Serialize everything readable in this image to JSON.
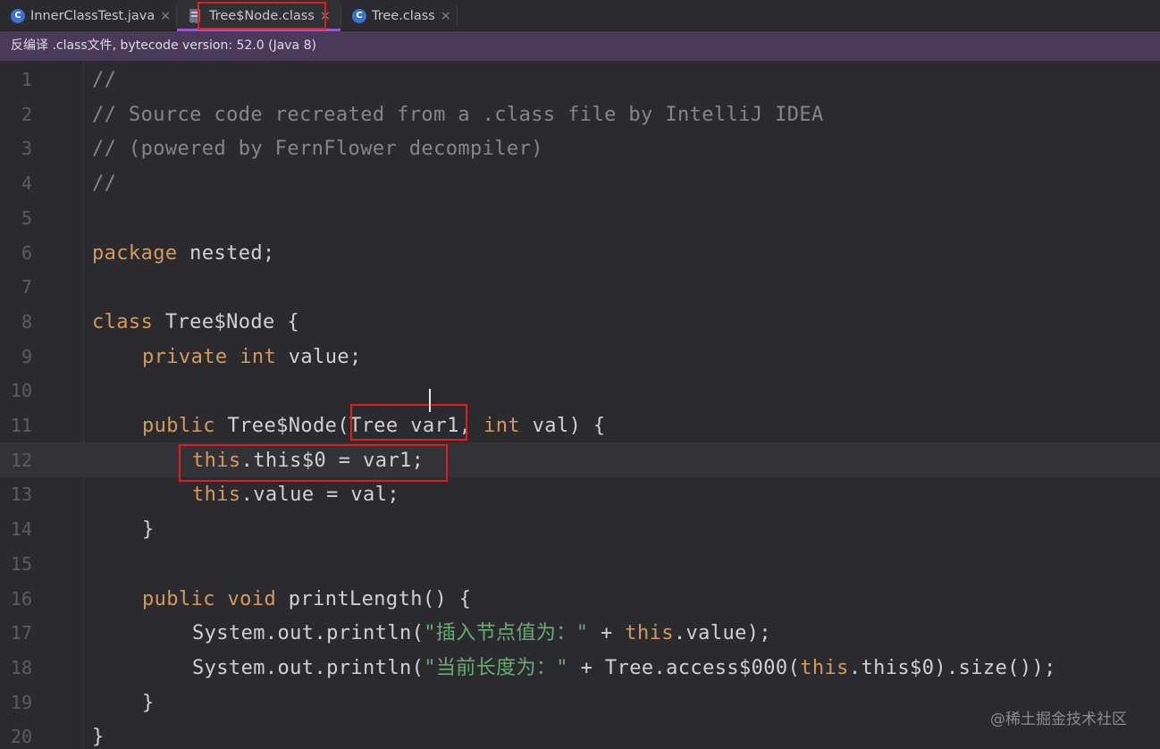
{
  "tabs": [
    {
      "label": "InnerClassTest.java",
      "icon": "java-class-icon",
      "icon_glyph": "C"
    },
    {
      "label": "Tree$Node.class",
      "icon": "bytecode-class-icon",
      "icon_glyph": ""
    },
    {
      "label": "Tree.class",
      "icon": "class-icon",
      "icon_glyph": "C"
    }
  ],
  "close_glyph": "×",
  "banner": {
    "text": "反编译 .class文件, bytecode version: 52.0 (Java 8)"
  },
  "editor": {
    "line_numbers": [
      "1",
      "2",
      "3",
      "4",
      "5",
      "6",
      "7",
      "8",
      "9",
      "10",
      "11",
      "12",
      "13",
      "14",
      "15",
      "16",
      "17",
      "18",
      "19",
      "20"
    ],
    "lines": {
      "l1": "//",
      "l2": "// Source code recreated from a .class file by IntelliJ IDEA",
      "l3": "// (powered by FernFlower decompiler)",
      "l4": "//",
      "l6_kw": "package",
      "l6_rest": " nested;",
      "l8_kw": "class",
      "l8_rest": " Tree$Node {",
      "l9_kw1": "private",
      "l9_kw2": "int",
      "l9_rest": " value;",
      "l11_kw": "public",
      "l11_mid": " Tree$Node(Tree var1, ",
      "l11_kw2": "int",
      "l11_rest": " val) {",
      "l12_kw": "this",
      "l12_rest": ".this$0 = var1;",
      "l13_kw": "this",
      "l13_rest": ".value = val;",
      "l14": "}",
      "l16_kw1": "public",
      "l16_kw2": "void",
      "l16_rest": " printLength() {",
      "l17_a": "System.out.println(",
      "l17_str": "\"插入节点值为：\"",
      "l17_b": " + ",
      "l17_kw": "this",
      "l17_c": ".value);",
      "l18_a": "System.out.println(",
      "l18_str": "\"当前长度为：\"",
      "l18_b": " + Tree.access$000(",
      "l18_kw": "this",
      "l18_c": ".this$0).size());",
      "l19": "}",
      "l20": "}"
    }
  },
  "watermark": "@稀土掘金技术社区",
  "colors": {
    "keyword": "#d49a5c",
    "comment": "#868686",
    "string": "#6aab73",
    "highlight_box": "#e01e1e",
    "active_tab_underline": "#9a58c9"
  }
}
